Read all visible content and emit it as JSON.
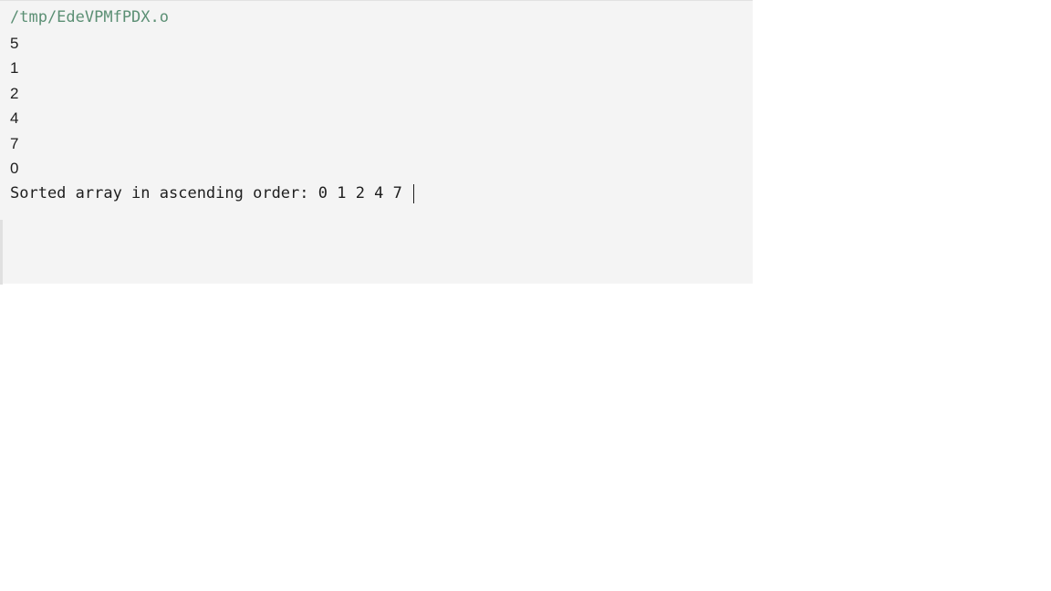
{
  "console": {
    "path": "/tmp/EdeVPMfPDX.o",
    "inputs": [
      "5",
      "1",
      "2",
      "4",
      "7",
      "0"
    ],
    "result": "Sorted array in ascending order: 0 1 2 4 7 "
  }
}
